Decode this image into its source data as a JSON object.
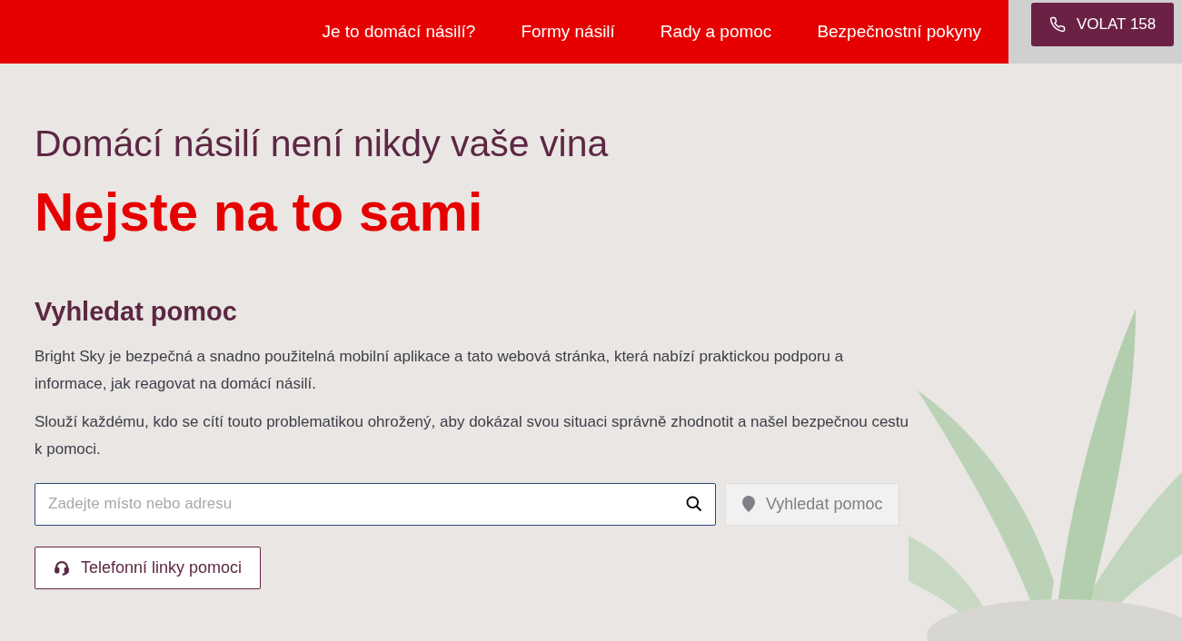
{
  "nav": {
    "links": [
      {
        "label": "Je to domácí násilí?"
      },
      {
        "label": "Formy násilí"
      },
      {
        "label": "Rady a pomoc"
      },
      {
        "label": "Bezpečnostní pokyny"
      }
    ],
    "call_button": "VOLAT 158"
  },
  "hero": {
    "subtitle": "Domácí násilí není nikdy vaše vina",
    "title": "Nejste na to sami"
  },
  "search_section": {
    "heading": "Vyhledat pomoc",
    "paragraphs": [
      "Bright Sky je bezpečná a snadno použitelná mobilní aplikace a tato webová stránka, která nabízí praktickou podporu a informace, jak reagovat na domácí násilí.",
      "Slouží každému, kdo se cítí touto problematikou ohrožený, aby dokázal svou situaci správně zhodnotit a našel bezpečnou cestu k pomoci."
    ],
    "search_field": {
      "placeholder": "Zadejte místo nebo adresu"
    },
    "search_button": {
      "label": "Vyhledat pomoc",
      "disabled": true
    },
    "helplines_button": "Telefonní linky pomoci"
  }
}
